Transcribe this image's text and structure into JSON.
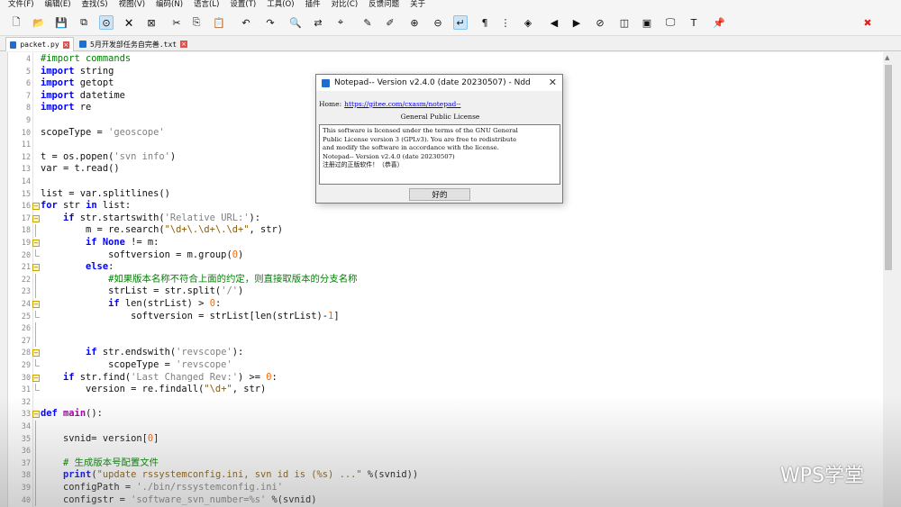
{
  "menu": [
    "文件(F)",
    "编辑(E)",
    "查找(S)",
    "视图(V)",
    "编码(N)",
    "语言(L)",
    "设置(T)",
    "工具(O)",
    "插件",
    "对比(C)",
    "反馈问题",
    "关于"
  ],
  "toolbar": {
    "icons": [
      "new-file-icon",
      "open-file-icon",
      "save-icon",
      "save-all-icon",
      "find-in-files-icon",
      "close-icon",
      "close-all-icon",
      "cut-icon",
      "copy-icon",
      "paste-icon",
      "undo-icon",
      "redo-icon",
      "find-icon",
      "find-replace-icon",
      "goto-icon",
      "marker-red-icon",
      "marker-clear-icon",
      "zoom-in-icon",
      "zoom-out-icon",
      "word-wrap-icon",
      "show-symbols-icon",
      "indent-guide-icon",
      "bookmark-icon",
      "prev-icon",
      "next-icon",
      "clear-icon",
      "split-icon",
      "panel-icon",
      "monitor-icon",
      "text-icon",
      "pin-icon",
      "close-red-icon"
    ]
  },
  "tabs": [
    {
      "label": "packet.py",
      "active": true
    },
    {
      "label": "5月开发部任务自完善.txt",
      "active": false
    }
  ],
  "lines": [
    {
      "n": "4",
      "html": "<span class=\"cm\">#import commands</span>"
    },
    {
      "n": "5",
      "html": "<span class=\"kw\">import</span> string"
    },
    {
      "n": "6",
      "html": "<span class=\"kw\">import</span> getopt"
    },
    {
      "n": "7",
      "html": "<span class=\"kw\">import</span> datetime"
    },
    {
      "n": "8",
      "html": "<span class=\"kw\">import</span> re"
    },
    {
      "n": "9",
      "html": ""
    },
    {
      "n": "10",
      "html": "scopeType = <span class=\"st\">'geoscope'</span>"
    },
    {
      "n": "11",
      "html": ""
    },
    {
      "n": "12",
      "html": "t = os.popen(<span class=\"st\">'svn info'</span>)"
    },
    {
      "n": "13",
      "html": "var = t.read()"
    },
    {
      "n": "14",
      "html": ""
    },
    {
      "n": "15",
      "html": "list = var.splitlines()"
    },
    {
      "n": "16",
      "html": "<span class=\"kw\">for</span> str <span class=\"kw\">in</span> list:",
      "fold": "start"
    },
    {
      "n": "17",
      "html": "    <span class=\"kw\">if</span> str.startswith(<span class=\"st\">'Relative URL:'</span>):",
      "fold": "start"
    },
    {
      "n": "18",
      "html": "        m = re.search(<span class=\"st2\">\"\\d+\\.\\d+\\.\\d+\"</span>, str)",
      "fold": "line"
    },
    {
      "n": "19",
      "html": "        <span class=\"kw\">if</span> <span class=\"kw\">None</span> != m:",
      "fold": "start"
    },
    {
      "n": "20",
      "html": "            softversion = m.group(<span class=\"nm\">0</span>)",
      "fold": "end"
    },
    {
      "n": "21",
      "html": "        <span class=\"kw\">else</span>:",
      "fold": "start"
    },
    {
      "n": "22",
      "html": "            <span class=\"cm\">#如果版本名称不符合上面的约定，则直接取版本的分支名称</span>",
      "fold": "line"
    },
    {
      "n": "23",
      "html": "            strList = str.split(<span class=\"st\">'/'</span>)",
      "fold": "line"
    },
    {
      "n": "24",
      "html": "            <span class=\"kw\">if</span> len(strList) > <span class=\"nm\">0</span>:",
      "fold": "start"
    },
    {
      "n": "25",
      "html": "                softversion = strList[len(strList)-<span class=\"nm\">1</span>]",
      "fold": "end"
    },
    {
      "n": "26",
      "html": "",
      "fold": "line"
    },
    {
      "n": "27",
      "html": "",
      "fold": "line"
    },
    {
      "n": "28",
      "html": "        <span class=\"kw\">if</span> str.endswith(<span class=\"st\">'revscope'</span>):",
      "fold": "start"
    },
    {
      "n": "29",
      "html": "            scopeType = <span class=\"st\">'revscope'</span>",
      "fold": "end"
    },
    {
      "n": "30",
      "html": "    <span class=\"kw\">if</span> str.find(<span class=\"st\">'Last Changed Rev:'</span>) >= <span class=\"nm\">0</span>:",
      "fold": "start"
    },
    {
      "n": "31",
      "html": "        version = re.findall(<span class=\"st2\">\"\\d+\"</span>, str)",
      "fold": "end"
    },
    {
      "n": "32",
      "html": ""
    },
    {
      "n": "33",
      "html": "<span class=\"kw\">def</span> <span class=\"fn\">main</span>():",
      "fold": "start"
    },
    {
      "n": "34",
      "html": "",
      "fold": "line"
    },
    {
      "n": "35",
      "html": "    svnid= version[<span class=\"nm\">0</span>]",
      "fold": "line"
    },
    {
      "n": "36",
      "html": "",
      "fold": "line"
    },
    {
      "n": "37",
      "html": "    <span class=\"cm\"># 生成版本号配置文件</span>",
      "fold": "line"
    },
    {
      "n": "38",
      "html": "    <span class=\"kw\">print</span>(<span class=\"st2\">\"update rssystemconfig.ini, svn id is (%s) ...\"</span> %(svnid))",
      "fold": "line"
    },
    {
      "n": "39",
      "html": "    configPath = <span class=\"st\">'./bin/rssystemconfig.ini'</span>",
      "fold": "line"
    },
    {
      "n": "40",
      "html": "    configstr = <span class=\"st\">'software_svn_number=%s'</span> %(svnid)",
      "fold": "line"
    }
  ],
  "dialog": {
    "title": "Notepad-- Version v2.4.0 (date 20230507) - Ndd",
    "home_label": "Home:",
    "home_link": "https://gitee.com/cxasm/notepad--",
    "gpl_heading": "General Public License",
    "license_lines": [
      "This software is licensed under the terms of the GNU General",
      "Public License version 3 (GPLv3). You are free to redistribute",
      "and modify the software in accordance with the license.",
      "Notepad-- Version v2.4.0 (date 20230507)",
      "注册过的正版软件！（恭喜）"
    ],
    "ok_label": "好的",
    "close_glyph": "✕"
  },
  "watermark": "WPS学堂"
}
